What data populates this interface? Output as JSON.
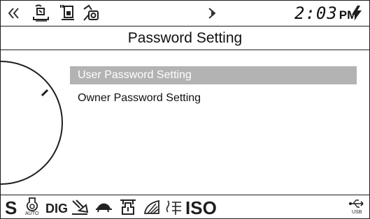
{
  "status_bar": {
    "icons": [
      "nav-prev-icon",
      "machine-warmup-icon",
      "fuel-gauge-icon",
      "maintenance-icon",
      "nav-next-icon",
      "lightning-bolt-icon"
    ],
    "time": "2:03",
    "ampm": "PM"
  },
  "title_bar": {
    "title": "Password Setting"
  },
  "menu": {
    "items": [
      {
        "label": "User Password Setting",
        "selected": true
      },
      {
        "label": "Owner Password Setting",
        "selected": false
      }
    ]
  },
  "bottom_bar": {
    "s_label": "S",
    "auto_label": "AUTO",
    "dig_label": "DIG",
    "iso_label": "ISO",
    "usb_label": "USB",
    "icons": [
      "auto-idle-icon",
      "dig-mode-icon",
      "travel-icon",
      "turtle-icon",
      "attachment-icon",
      "wiper-icon",
      "heater-icon",
      "usb-icon"
    ]
  },
  "colors": {
    "selected_bg": "#b3b3b3",
    "selected_text": "#ffffff",
    "line": "#1e1e1e"
  }
}
